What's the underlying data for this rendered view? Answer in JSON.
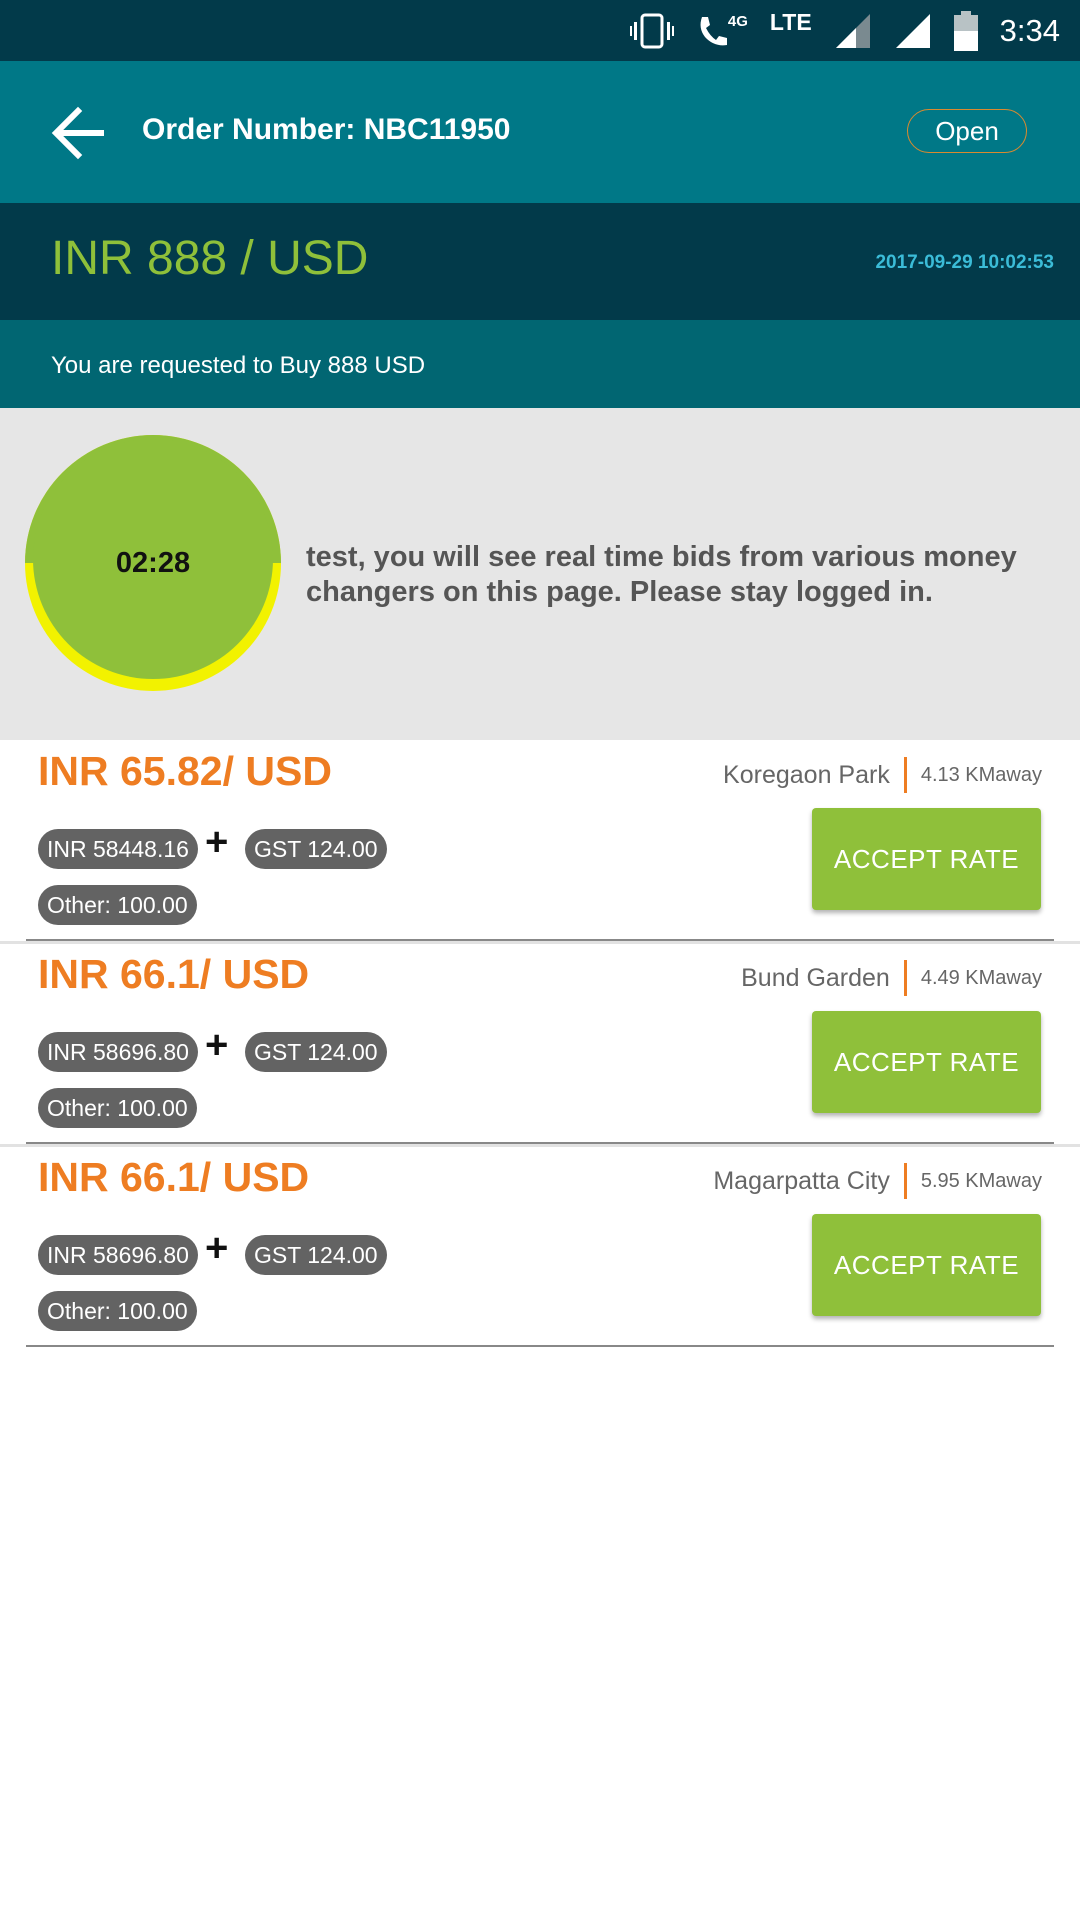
{
  "status_bar": {
    "network": "LTE",
    "network_small": "4G",
    "time": "3:34"
  },
  "header": {
    "title": "Order Number: NBC11950",
    "status": "Open"
  },
  "rate_band": {
    "rate": "INR 888 / USD",
    "timestamp": "2017-09-29 10:02:53"
  },
  "request": {
    "text": "You are requested to Buy 888 USD"
  },
  "timer": {
    "time": "02:28",
    "message": "test, you will see real time bids from various money changers on this page. Please stay logged in."
  },
  "bids": [
    {
      "rate": "INR 65.82/ USD",
      "location": "Koregaon Park",
      "distance": "4.13 KMaway",
      "amount": "INR 58448.16",
      "plus": "+",
      "gst": "GST 124.00",
      "other": "Other: 100.00",
      "action": "ACCEPT RATE"
    },
    {
      "rate": "INR 66.1/ USD",
      "location": "Bund Garden",
      "distance": "4.49 KMaway",
      "amount": "INR 58696.80",
      "plus": "+",
      "gst": "GST 124.00",
      "other": "Other: 100.00",
      "action": "ACCEPT RATE"
    },
    {
      "rate": "INR 66.1/ USD",
      "location": "Magarpatta City",
      "distance": "5.95 KMaway",
      "amount": "INR 58696.80",
      "plus": "+",
      "gst": "GST 124.00",
      "other": "Other: 100.00",
      "action": "ACCEPT RATE"
    }
  ],
  "colors": {
    "status_bar": "#023a4a",
    "app_bar": "#007887",
    "rate_band": "#023a4a",
    "request_band": "#016672",
    "accent_green": "#8fc03a",
    "accent_orange": "#ee7d22",
    "timer_ring": "#f2f200",
    "chip": "#636363"
  },
  "icons": [
    "vibrate-icon",
    "call-icon",
    "signal-icon",
    "battery-icon",
    "back-arrow-icon"
  ]
}
